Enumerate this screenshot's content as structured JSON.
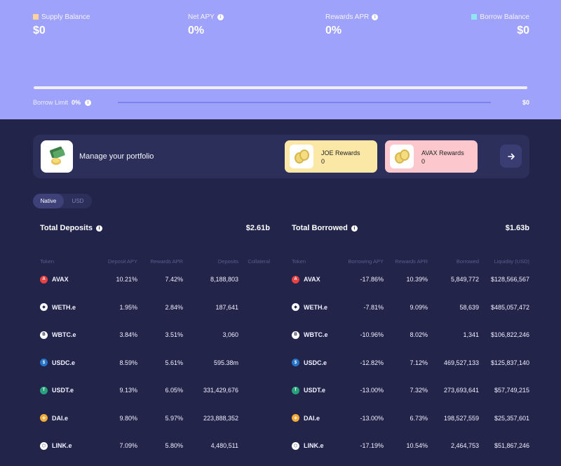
{
  "summary": {
    "supply_label": "Supply Balance",
    "supply_value": "$0",
    "net_apy_label": "Net APY",
    "net_apy_value": "0%",
    "rewards_apr_label": "Rewards APR",
    "rewards_apr_value": "0%",
    "borrow_label": "Borrow Balance",
    "borrow_value": "$0",
    "supply_color": "#f9d49a",
    "borrow_color": "#8fe6ee"
  },
  "borrow_limit": {
    "label": "Borrow Limit",
    "percent": "0%",
    "amount": "$0",
    "fill_fraction": 0
  },
  "portfolio": {
    "title": "Manage your portfolio",
    "joe_title": "JOE Rewards",
    "joe_value": "0",
    "avax_title": "AVAX Rewards",
    "avax_value": "0"
  },
  "toggle": {
    "native": "Native",
    "usd": "USD",
    "selected": "Native"
  },
  "deposits": {
    "title": "Total Deposits",
    "total": "$2.61b",
    "columns": [
      "Token",
      "Deposit APY",
      "Rewards APR",
      "Deposits",
      "Collateral"
    ],
    "rows": [
      {
        "token": "AVAX",
        "apy": "10.21%",
        "apr": "7.42%",
        "amount": "8,188,803",
        "collateral": ""
      },
      {
        "token": "WETH.e",
        "apy": "1.95%",
        "apr": "2.84%",
        "amount": "187,641",
        "collateral": ""
      },
      {
        "token": "WBTC.e",
        "apy": "3.84%",
        "apr": "3.51%",
        "amount": "3,060",
        "collateral": ""
      },
      {
        "token": "USDC.e",
        "apy": "8.59%",
        "apr": "5.61%",
        "amount": "595.38m",
        "collateral": ""
      },
      {
        "token": "USDT.e",
        "apy": "9.13%",
        "apr": "6.05%",
        "amount": "331,429,676",
        "collateral": ""
      },
      {
        "token": "DAI.e",
        "apy": "9.80%",
        "apr": "5.97%",
        "amount": "223,888,352",
        "collateral": ""
      },
      {
        "token": "LINK.e",
        "apy": "7.09%",
        "apr": "5.80%",
        "amount": "4,480,511",
        "collateral": ""
      }
    ]
  },
  "borrowed": {
    "title": "Total Borrowed",
    "total": "$1.63b",
    "columns": [
      "Token",
      "Borrowing APY",
      "Rewards APR",
      "Borrowed",
      "Liquidity (USD)"
    ],
    "rows": [
      {
        "token": "AVAX",
        "apy": "-17.86%",
        "apr": "10.39%",
        "amount": "5,849,772",
        "liquidity": "$128,566,567"
      },
      {
        "token": "WETH.e",
        "apy": "-7.81%",
        "apr": "9.09%",
        "amount": "58,639",
        "liquidity": "$485,057,472"
      },
      {
        "token": "WBTC.e",
        "apy": "-10.96%",
        "apr": "8.02%",
        "amount": "1,341",
        "liquidity": "$106,822,246"
      },
      {
        "token": "USDC.e",
        "apy": "-12.82%",
        "apr": "7.12%",
        "amount": "469,527,133",
        "liquidity": "$125,837,140"
      },
      {
        "token": "USDT.e",
        "apy": "-13.00%",
        "apr": "7.32%",
        "amount": "273,693,641",
        "liquidity": "$57,749,215"
      },
      {
        "token": "DAI.e",
        "apy": "-13.00%",
        "apr": "6.73%",
        "amount": "198,527,559",
        "liquidity": "$25,357,601"
      },
      {
        "token": "LINK.e",
        "apy": "-17.19%",
        "apr": "10.54%",
        "amount": "2,464,753",
        "liquidity": "$51,867,246"
      }
    ]
  },
  "token_icons": {
    "AVAX": {
      "icon": "avax-icon",
      "color": "#e84142"
    },
    "WETH.e": {
      "icon": "ethereum-icon",
      "color": "#ffffff"
    },
    "WBTC.e": {
      "icon": "bitcoin-icon",
      "color": "#ffffff"
    },
    "USDC.e": {
      "icon": "usdc-icon",
      "color": "#2775ca"
    },
    "USDT.e": {
      "icon": "tether-icon",
      "color": "#26a17b"
    },
    "DAI.e": {
      "icon": "dai-icon",
      "color": "#f5ac37"
    },
    "LINK.e": {
      "icon": "chainlink-icon",
      "color": "#ffffff"
    }
  }
}
